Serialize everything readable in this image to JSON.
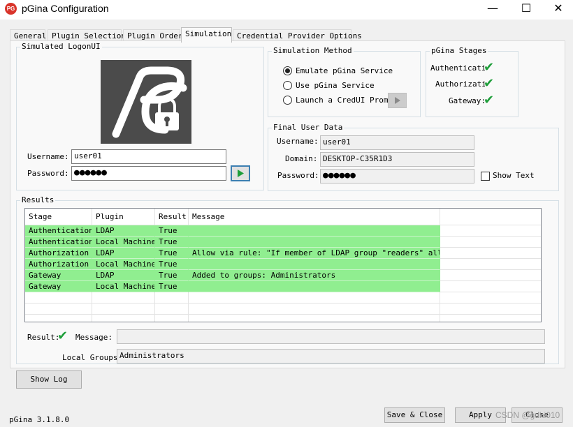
{
  "app": {
    "title": "pGina Configuration",
    "icon_label": "PG",
    "version": "pGina 3.1.8.0",
    "watermark": "CSDN @gdhi010"
  },
  "window_controls": {
    "minimize": "—",
    "maximize": "☐",
    "close": "✕"
  },
  "tabs": [
    {
      "label": "General"
    },
    {
      "label": "Plugin Selection"
    },
    {
      "label": "Plugin Order"
    },
    {
      "label": "Simulation"
    },
    {
      "label": "Credential Provider Options"
    }
  ],
  "active_tab": "Simulation",
  "logon": {
    "legend": "Simulated LogonUI",
    "username_label": "Username:",
    "username": "user01",
    "password_label": "Password:",
    "password_mask": "●●●●●●"
  },
  "method": {
    "legend": "Simulation Method",
    "options": [
      {
        "label": "Emulate pGina Service",
        "checked": true
      },
      {
        "label": "Use pGina Service",
        "checked": false
      },
      {
        "label": "Launch a CredUI Prompt",
        "checked": false
      }
    ]
  },
  "stages": {
    "legend": "pGina Stages",
    "items": [
      {
        "label": "Authenticatic",
        "status": "ok"
      },
      {
        "label": "Authorizatic",
        "status": "ok"
      },
      {
        "label": "Gateway:",
        "status": "ok"
      }
    ]
  },
  "final": {
    "legend": "Final User Data",
    "username_label": "Username:",
    "username": "user01",
    "domain_label": "Domain:",
    "domain": "DESKTOP-C35R1D3",
    "password_label": "Password:",
    "password_mask": "●●●●●●",
    "show_text_label": "Show Text",
    "show_text_checked": false
  },
  "results": {
    "legend": "Results",
    "columns": [
      "Stage",
      "Plugin",
      "Result",
      "Message"
    ],
    "rows": [
      {
        "stage": "Authentication",
        "plugin": "LDAP",
        "result": "True",
        "message": ""
      },
      {
        "stage": "Authentication",
        "plugin": "Local Machine",
        "result": "True",
        "message": ""
      },
      {
        "stage": "Authorization",
        "plugin": "LDAP",
        "result": "True",
        "message": "Allow via rule: \"If member of LDAP group \"readers\" allow.\""
      },
      {
        "stage": "Authorization",
        "plugin": "Local Machine",
        "result": "True",
        "message": ""
      },
      {
        "stage": "Gateway",
        "plugin": "LDAP",
        "result": "True",
        "message": "Added to groups: Administrators"
      },
      {
        "stage": "Gateway",
        "plugin": "Local Machine",
        "result": "True",
        "message": ""
      }
    ],
    "result_label": "Result:",
    "result_status": "ok",
    "message_label": "Message:",
    "message": "",
    "local_groups_label": "Local Groups:",
    "local_groups": "Administrators"
  },
  "buttons": {
    "show_log": "Show Log",
    "save_close": "Save & Close",
    "apply": "Apply",
    "close": "Close"
  },
  "colors": {
    "success_row": "#90ee90",
    "check_green": "#1e9e3a",
    "logo_bg": "#4b4b4b"
  }
}
